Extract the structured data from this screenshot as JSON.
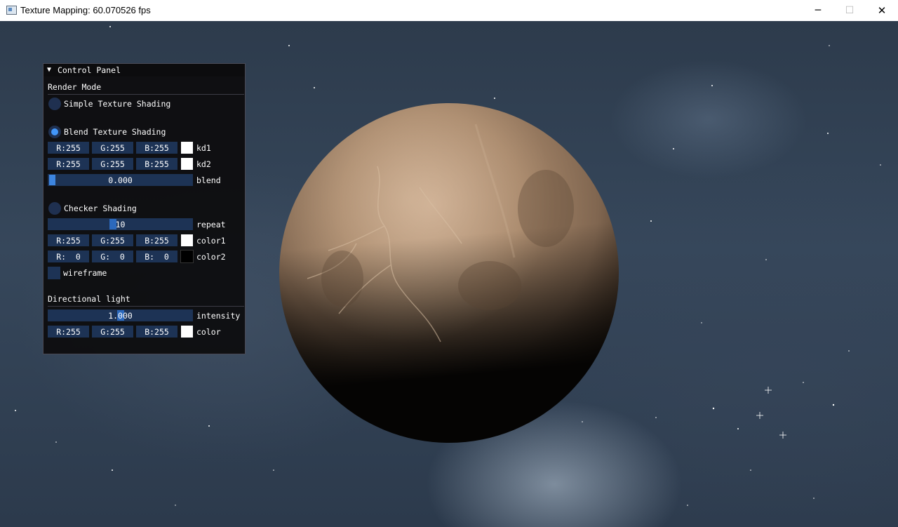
{
  "window": {
    "title": "Texture Mapping: 60.070526 fps",
    "minimize_glyph": "─",
    "maximize_glyph": "☐",
    "close_glyph": "✕"
  },
  "panel": {
    "collapse_glyph": "▼",
    "title": "Control Panel",
    "render_mode": {
      "heading": "Render Mode",
      "selected": "Blend Texture Shading",
      "simple": {
        "label": "Simple Texture Shading"
      },
      "blend": {
        "label": "Blend Texture Shading",
        "kd1": {
          "r": "R:255",
          "g": "G:255",
          "b": "B:255",
          "color": "#ffffff",
          "label": "kd1"
        },
        "kd2": {
          "r": "R:255",
          "g": "G:255",
          "b": "B:255",
          "color": "#ffffff",
          "label": "kd2"
        },
        "blend": {
          "value": "0.000",
          "fraction": 0.0,
          "label": "blend"
        }
      },
      "checker": {
        "label": "Checker Shading",
        "repeat": {
          "value": "10",
          "label": "repeat"
        },
        "color1": {
          "r": "R:255",
          "g": "G:255",
          "b": "B:255",
          "color": "#ffffff",
          "label": "color1"
        },
        "color2": {
          "r": "R:  0",
          "g": "G:  0",
          "b": "B:  0",
          "color": "#000000",
          "label": "color2"
        },
        "wireframe": {
          "label": "wireframe",
          "checked": false
        }
      }
    },
    "light": {
      "heading": "Directional light",
      "intensity": {
        "value": "1.000",
        "label": "intensity"
      },
      "color": {
        "r": "R:255",
        "g": "G:255",
        "b": "B:255",
        "color": "#ffffff",
        "label": "color"
      }
    }
  },
  "colors": {
    "accent": "#4296fa",
    "field_bg": "#1d3355",
    "panel_bg": "#0e0e10"
  }
}
